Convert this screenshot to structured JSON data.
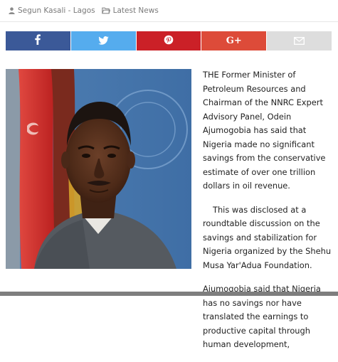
{
  "meta": {
    "author": "Segun Kasali - Lagos",
    "category": "Latest News",
    "author_icon": "user-icon",
    "category_icon": "folder-icon"
  },
  "share": [
    {
      "name": "facebook",
      "icon": "facebook-icon",
      "color": "#3b5998"
    },
    {
      "name": "twitter",
      "icon": "twitter-icon",
      "color": "#55acee"
    },
    {
      "name": "pinterest",
      "icon": "pinterest-icon",
      "color": "#cb2027"
    },
    {
      "name": "google-plus",
      "icon": "google-plus-icon",
      "color": "#dd4b39",
      "label": "G+"
    },
    {
      "name": "email",
      "icon": "mail-icon",
      "color": "#dddddd"
    }
  ],
  "article": {
    "paragraphs": [
      "THE Former Minister of Petroleum Resources and Chairman of the NNRC Expert Advisory Panel, Odein Ajumogobia has said that Nigeria made no significant savings from the conservative estimate of over one trillion dollars in oil revenue.",
      "This was disclosed at a roundtable discussion on the savings and stabilization for Nigeria organized by the Shehu Musa Yar'Adua Foundation.",
      "Ajumogobia said that Nigeria has no savings nor have translated the earnings to productive capital through human development,"
    ]
  }
}
